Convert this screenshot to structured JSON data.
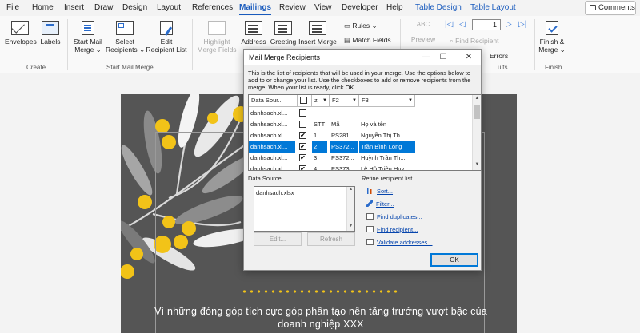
{
  "tabs": [
    "File",
    "Home",
    "Insert",
    "Draw",
    "Design",
    "Layout",
    "References",
    "Mailings",
    "Review",
    "View",
    "Developer",
    "Help",
    "Table Design",
    "Table Layout"
  ],
  "active_tab": "Mailings",
  "comments_label": "Comments",
  "ribbon": {
    "envelopes": "Envelopes",
    "labels": "Labels",
    "create_group": "Create",
    "start_mail_merge_1": "Start Mail",
    "start_mail_merge_2": "Merge",
    "select_recipients_1": "Select",
    "select_recipients_2": "Recipients",
    "edit_recipient_1": "Edit",
    "edit_recipient_2": "Recipient List",
    "start_group": "Start Mail Merge",
    "highlight_1": "Highlight",
    "highlight_2": "Merge Fields",
    "address_1": "Address",
    "greeting_1": "Greeting",
    "insert_merge_1": "Insert Merge",
    "rules": "Rules",
    "match_fields": "Match Fields",
    "preview_1": "Preview",
    "preview_abc": "ABC",
    "record_number": "1",
    "find_recipient": "Find Recipient",
    "check_errors": "Errors",
    "results_group": "ults",
    "finish_1": "Finish &",
    "finish_2": "Merge",
    "finish_group": "Finish"
  },
  "dialog": {
    "title": "Mail Merge Recipients",
    "description": "This is the list of recipients that will be used in your merge.  Use the options below to add to or change your list.  Use the checkboxes to add or remove recipients from the merge.  When your list is ready, click OK.",
    "columns": [
      "Data Sour...",
      "",
      "z",
      "F2",
      "F3"
    ],
    "rows": [
      {
        "source": "danhsach.xl...",
        "checked": false,
        "stt": "",
        "ma": "",
        "name": "",
        "selected": false
      },
      {
        "source": "danhsach.xl...",
        "checked": false,
        "stt": "STT",
        "ma": "Mã",
        "name": "Họ và tên",
        "selected": false
      },
      {
        "source": "danhsach.xl...",
        "checked": true,
        "stt": "1",
        "ma": "PS281...",
        "name": "Nguyễn Thị Th...",
        "selected": false
      },
      {
        "source": "danhsach.xl...",
        "checked": true,
        "stt": "2",
        "ma": "PS372...",
        "name": "Trần Bình Long",
        "selected": true
      },
      {
        "source": "danhsach.xl...",
        "checked": true,
        "stt": "3",
        "ma": "PS372...",
        "name": "Huỳnh Trần Th...",
        "selected": false
      },
      {
        "source": "danhsach.xl...",
        "checked": true,
        "stt": "4",
        "ma": "PS373...",
        "name": "Lê Hồ Triều Huy",
        "selected": false
      }
    ],
    "data_source_label": "Data Source",
    "data_source_item": "danhsach.xlsx",
    "edit_button": "Edit...",
    "refresh_button": "Refresh",
    "refine_label": "Refine recipient list",
    "refine_links": [
      "Sort...",
      "Filter...",
      "Find duplicates...",
      "Find recipient...",
      "Validate addresses..."
    ],
    "ok_button": "OK"
  },
  "document": {
    "caption_line1": "Vì những đóng góp tích cực góp phần tạo nên tăng trưởng vượt bậc của",
    "caption_line2": "doanh nghiệp XXX",
    "colors": {
      "background": "#555555",
      "accent": "#f2c318",
      "leaf_light": "#e9e9e9",
      "leaf_mid": "#8a8a8a"
    }
  }
}
